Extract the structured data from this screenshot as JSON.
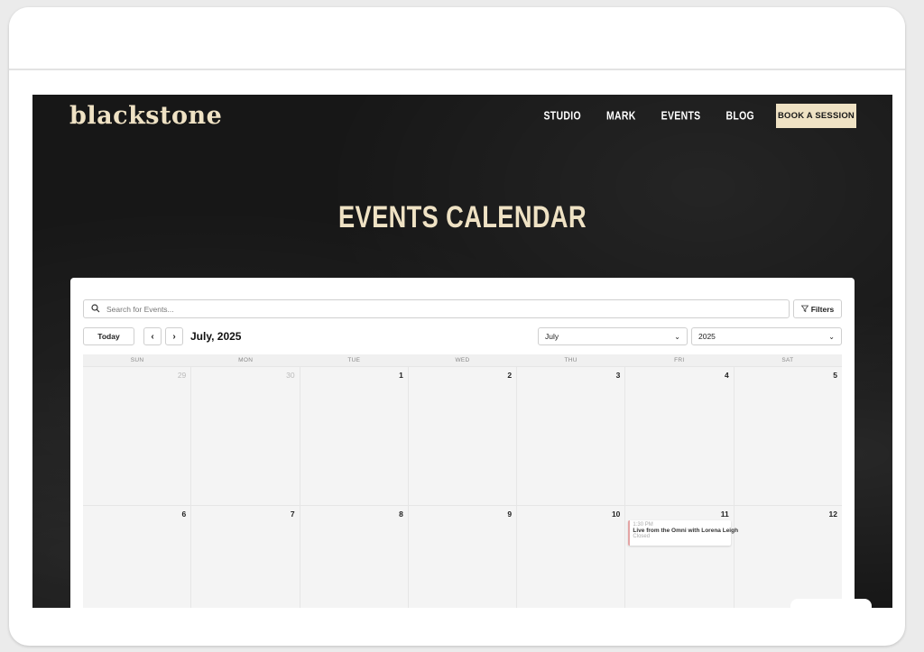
{
  "site": {
    "logo": "blackstone",
    "nav": [
      "STUDIO",
      "MARK",
      "EVENTS",
      "BLOG"
    ],
    "cta": "BOOK A SESSION",
    "hero_title": "EVENTS CALENDAR"
  },
  "toolbar": {
    "search_placeholder": "Search for Events...",
    "filters_label": "Filters",
    "today_label": "Today",
    "prev_label": "‹",
    "next_label": "›",
    "current_month": "July, 2025",
    "month_select": "July",
    "year_select": "2025"
  },
  "calendar": {
    "weekdays": [
      "SUN",
      "MON",
      "TUE",
      "WED",
      "THU",
      "FRI",
      "SAT"
    ],
    "weeks": [
      [
        "29",
        "30",
        "1",
        "2",
        "3",
        "4",
        "5"
      ],
      [
        "6",
        "7",
        "8",
        "9",
        "10",
        "11",
        "12"
      ]
    ],
    "event": {
      "time": "1:30 PM",
      "title": "Live from the Omni with Lorena Leigh",
      "status": "Closed"
    }
  },
  "colors": {
    "background": "#171717",
    "accent": "#efe2c4"
  }
}
